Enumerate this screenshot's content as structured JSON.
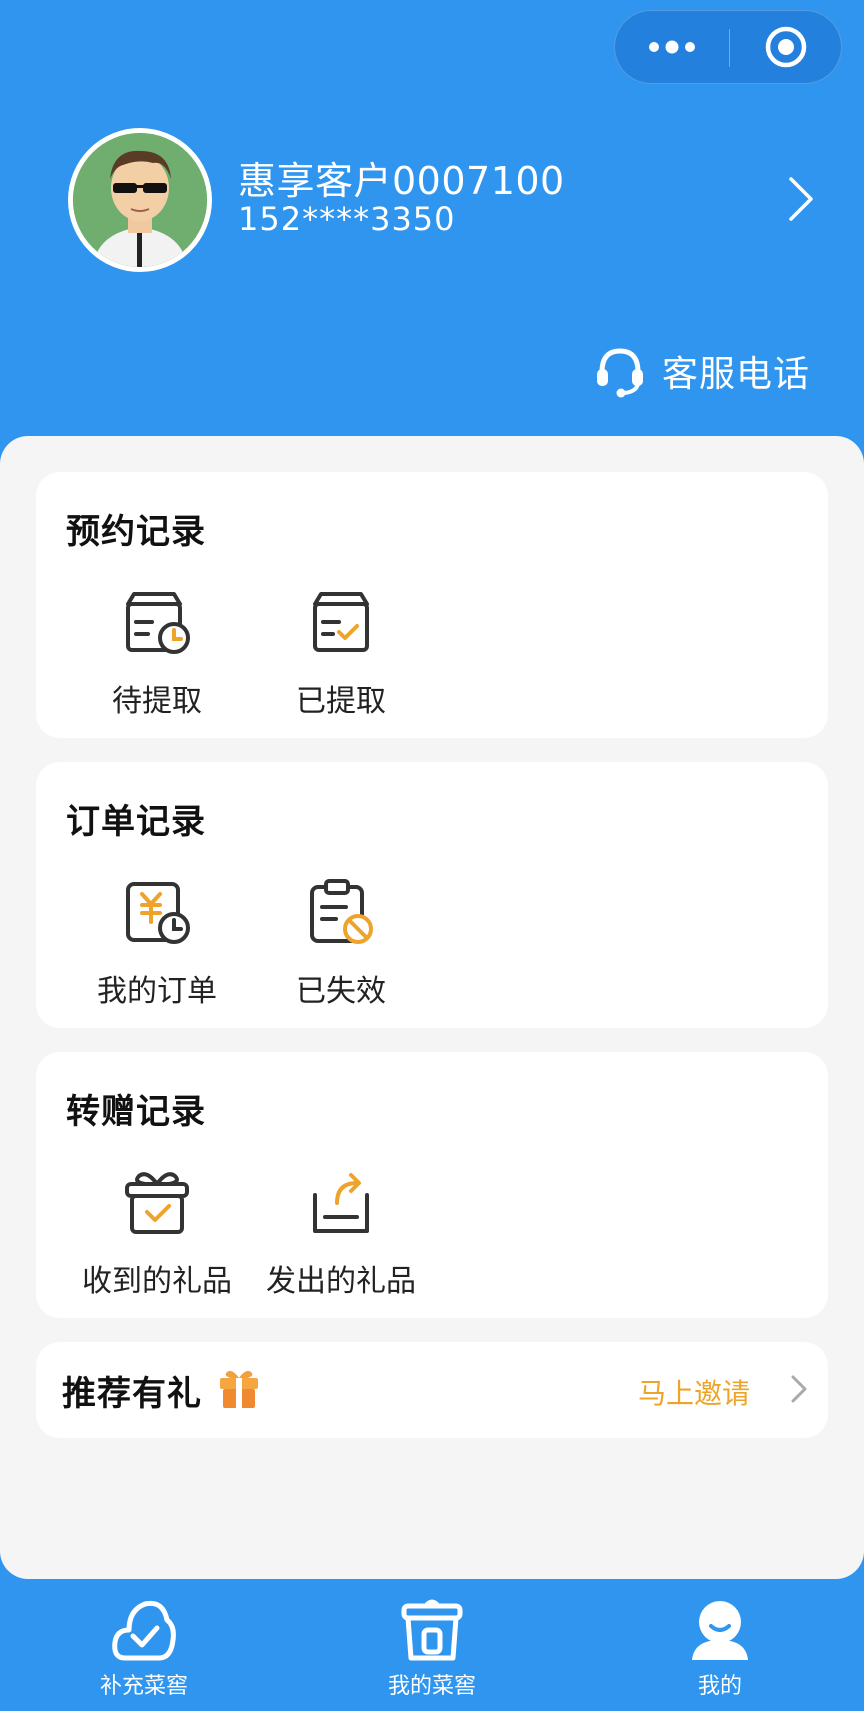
{
  "capsule": {
    "more_icon": "more-dots-icon",
    "close_icon": "target-circle-icon"
  },
  "profile": {
    "name": "惠享客户0007100",
    "phone": "152****3350"
  },
  "service": {
    "label": "客服电话",
    "icon": "headset-icon"
  },
  "sections": {
    "reservation": {
      "title": "预约记录",
      "items": [
        {
          "label": "待提取",
          "icon": "box-clock-icon"
        },
        {
          "label": "已提取",
          "icon": "box-check-icon"
        }
      ]
    },
    "orders": {
      "title": "订单记录",
      "items": [
        {
          "label": "我的订单",
          "icon": "yuan-clock-icon"
        },
        {
          "label": "已失效",
          "icon": "clipboard-forbidden-icon"
        }
      ]
    },
    "gifts": {
      "title": "转赠记录",
      "items": [
        {
          "label": "收到的礼品",
          "icon": "gift-box-check-icon"
        },
        {
          "label": "发出的礼品",
          "icon": "tray-share-icon"
        }
      ]
    }
  },
  "referral": {
    "title": "推荐有礼",
    "link": "马上邀请"
  },
  "tabbar": {
    "items": [
      {
        "label": "补充菜窖",
        "icon": "cloud-check-icon"
      },
      {
        "label": "我的菜窖",
        "icon": "cellar-jar-icon"
      },
      {
        "label": "我的",
        "icon": "user-smile-icon"
      }
    ]
  },
  "colors": {
    "brand": "#2f95ee",
    "accent": "#eea42a",
    "background": "#f5f5f6"
  }
}
